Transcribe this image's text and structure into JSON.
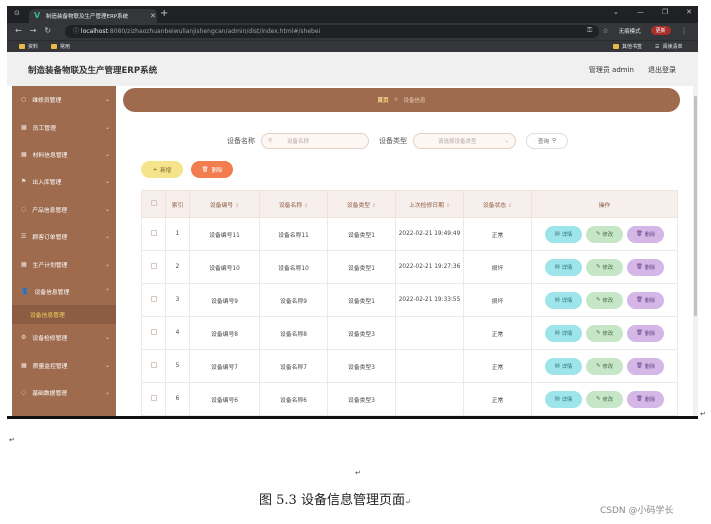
{
  "browser": {
    "tab_title": "制造装备物联及生产管理ERP系统",
    "url_host": "localhost",
    "url_rest": ":8080/zizhaozhuanbeiwulianjishengcan/admin/dist/index.html#/shebei",
    "incognito_label": "无痕模式",
    "update_label": "更新",
    "bookmarks": [
      "资料",
      "常用"
    ],
    "bookmarks_right": [
      "其他书签",
      "阅读清单"
    ]
  },
  "header": {
    "title": "制造装备物联及生产管理ERP系统",
    "user": "管理员 admin",
    "logout": "退出登录"
  },
  "sidebar": {
    "items": [
      {
        "label": "维修员管理",
        "icon": "user-icon"
      },
      {
        "label": "员工管理",
        "icon": "grid-icon"
      },
      {
        "label": "材料信息管理",
        "icon": "grid-icon"
      },
      {
        "label": "出入库管理",
        "icon": "flag-icon"
      },
      {
        "label": "产品信息管理",
        "icon": "circle-icon"
      },
      {
        "label": "顾客订单管理",
        "icon": "list-icon"
      },
      {
        "label": "生产计划管理",
        "icon": "grid-icon"
      },
      {
        "label": "设备信息管理",
        "icon": "user-icon"
      }
    ],
    "sub_item": "设备信息管理",
    "items_after": [
      {
        "label": "设备检修管理",
        "icon": "gear-icon"
      },
      {
        "label": "质量监控管理",
        "icon": "grid-icon"
      },
      {
        "label": "基础数据管理",
        "icon": "circle-icon"
      }
    ]
  },
  "breadcrumb": {
    "home": "首页",
    "current": "设备信息"
  },
  "search": {
    "name_label": "设备名称",
    "name_placeholder": "设备名称",
    "type_label": "设备类型",
    "type_placeholder": "请选择设备类型",
    "query": "查询"
  },
  "actions": {
    "add": "新增",
    "delete": "删除"
  },
  "table": {
    "headers": [
      "索引",
      "设备编号",
      "设备名称",
      "设备类型",
      "上次检修日期",
      "设备状态",
      "操作"
    ],
    "op_labels": {
      "detail": "详情",
      "edit": "修改",
      "delete": "删除"
    },
    "rows": [
      {
        "idx": "1",
        "code": "设备编号11",
        "name": "设备名称11",
        "type": "设备类型1",
        "date": "2022-02-21 19:49:49",
        "status": "正常"
      },
      {
        "idx": "2",
        "code": "设备编号10",
        "name": "设备名称10",
        "type": "设备类型1",
        "date": "2022-02-21 19:27:36",
        "status": "损坏"
      },
      {
        "idx": "3",
        "code": "设备编号9",
        "name": "设备名称9",
        "type": "设备类型1",
        "date": "2022-02-21 19:33:55",
        "status": "损坏"
      },
      {
        "idx": "4",
        "code": "设备编号8",
        "name": "设备名称8",
        "type": "设备类型3",
        "date": "",
        "status": "正常"
      },
      {
        "idx": "5",
        "code": "设备编号7",
        "name": "设备名称7",
        "type": "设备类型3",
        "date": "",
        "status": "正常"
      },
      {
        "idx": "6",
        "code": "设备编号6",
        "name": "设备名称6",
        "type": "设备类型3",
        "date": "",
        "status": "正常"
      }
    ]
  },
  "caption": "图 5.3 设备信息管理页面",
  "watermark": "CSDN @小码学长"
}
